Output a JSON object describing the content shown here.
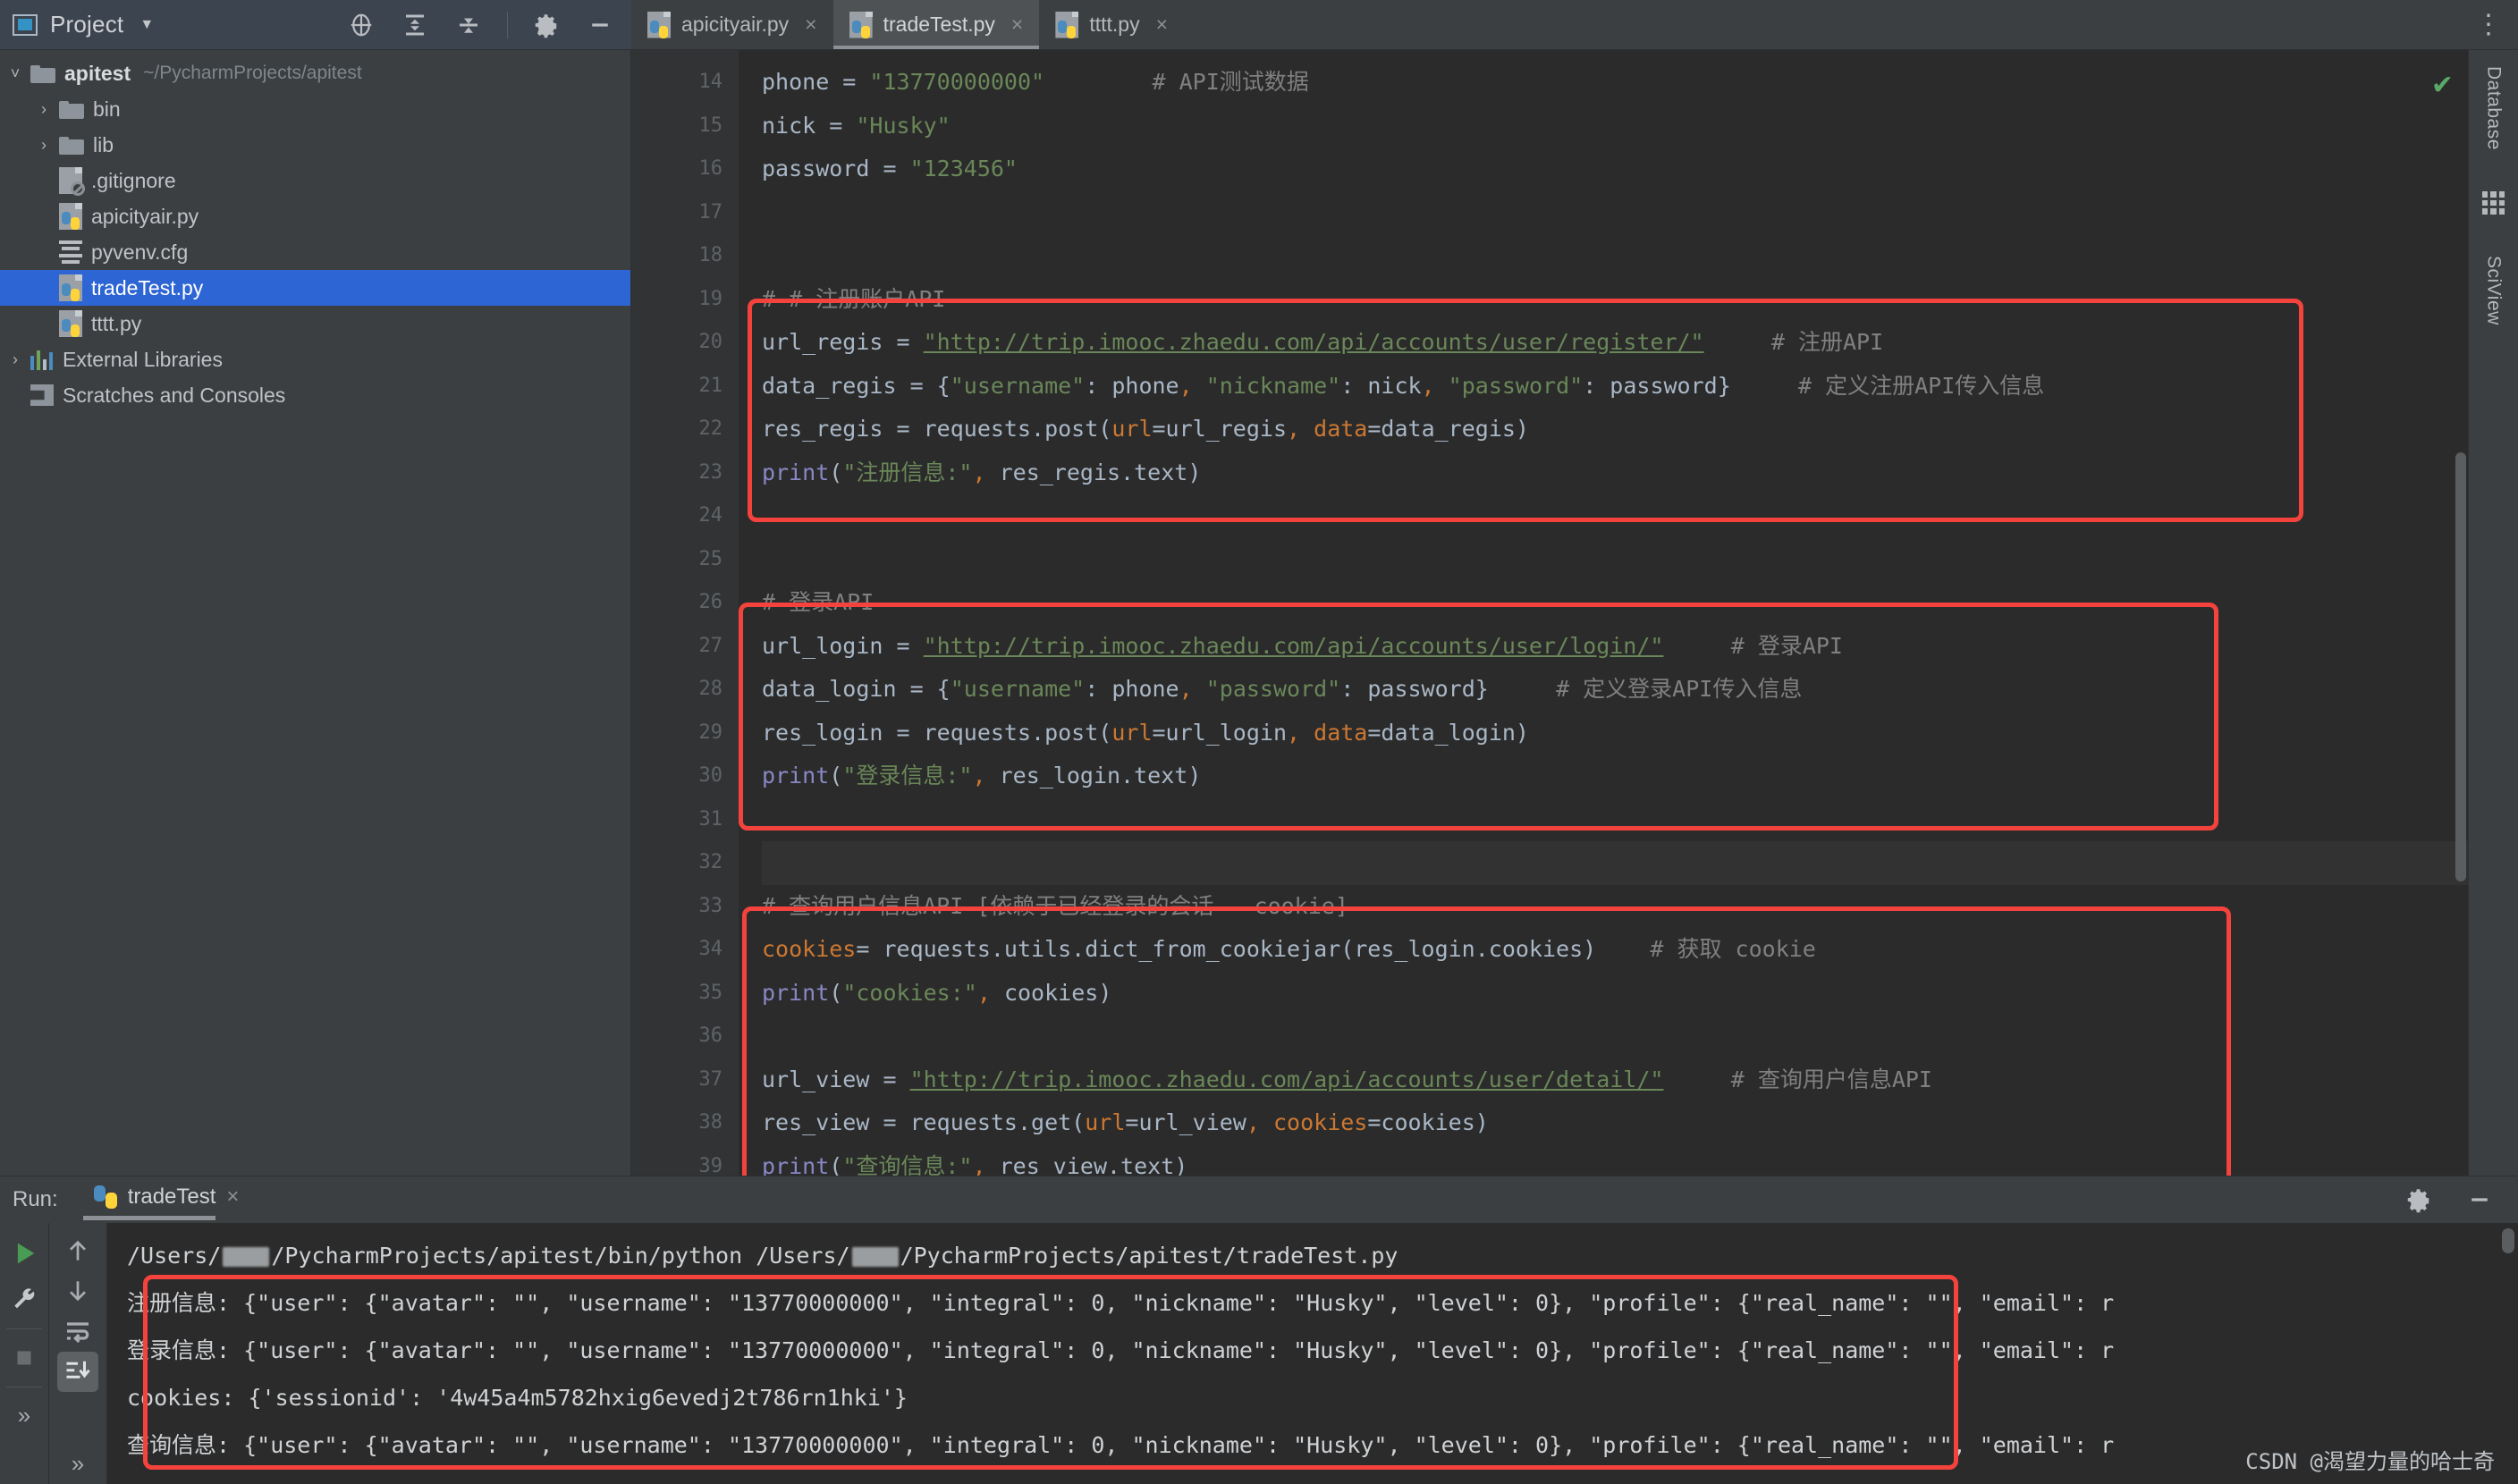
{
  "window": {
    "project_panel_title": "Project",
    "toolbar_icons": [
      "locate-icon",
      "expand-all-icon",
      "collapse-all-icon",
      "gear-icon",
      "minimize-icon"
    ]
  },
  "tabs": [
    {
      "label": "apicityair.py",
      "icon": "python-file-icon",
      "active": false,
      "close": "×"
    },
    {
      "label": "tradeTest.py",
      "icon": "python-file-icon",
      "active": true,
      "close": "×"
    },
    {
      "label": "tttt.py",
      "icon": "python-file-icon",
      "active": false,
      "close": "×"
    }
  ],
  "tabbar_overflow": "⋮",
  "tree": [
    {
      "label": "apitest",
      "sub": "~/PycharmProjects/apitest",
      "icon": "folder-icon",
      "arrow": "˅",
      "indent": 0,
      "bold": true,
      "selected": false
    },
    {
      "label": "bin",
      "sub": "",
      "icon": "folder-icon",
      "arrow": "›",
      "indent": 1,
      "bold": false,
      "selected": false
    },
    {
      "label": "lib",
      "sub": "",
      "icon": "folder-icon",
      "arrow": "›",
      "indent": 1,
      "bold": false,
      "selected": false
    },
    {
      "label": ".gitignore",
      "sub": "",
      "icon": "gitignore-file-icon",
      "arrow": "",
      "indent": 2,
      "bold": false,
      "selected": false
    },
    {
      "label": "apicityair.py",
      "sub": "",
      "icon": "python-file-icon",
      "arrow": "",
      "indent": 2,
      "bold": false,
      "selected": false
    },
    {
      "label": "pyvenv.cfg",
      "sub": "",
      "icon": "config-file-icon",
      "arrow": "",
      "indent": 2,
      "bold": false,
      "selected": false
    },
    {
      "label": "tradeTest.py",
      "sub": "",
      "icon": "python-file-icon",
      "arrow": "",
      "indent": 2,
      "bold": false,
      "selected": true
    },
    {
      "label": "tttt.py",
      "sub": "",
      "icon": "python-file-icon",
      "arrow": "",
      "indent": 2,
      "bold": false,
      "selected": false
    },
    {
      "label": "External Libraries",
      "sub": "",
      "icon": "library-icon",
      "arrow": "›",
      "indent": 0,
      "bold": false,
      "selected": false
    },
    {
      "label": "Scratches and Consoles",
      "sub": "",
      "icon": "scratches-icon",
      "arrow": "",
      "indent": 0,
      "bold": false,
      "selected": false
    }
  ],
  "editor": {
    "first_line_number": 14,
    "line_numbers": [
      14,
      15,
      16,
      17,
      18,
      19,
      20,
      21,
      22,
      23,
      24,
      25,
      26,
      27,
      28,
      29,
      30,
      31,
      32,
      33,
      34,
      35,
      36,
      37,
      38,
      39
    ],
    "current_line": 32,
    "lines": [
      "phone = \"13770000000\"        # API测试数据",
      "nick = \"Husky\"",
      "password = \"123456\"",
      "",
      "",
      "# # 注册账户API",
      "url_regis = \"http://trip.imooc.zhaedu.com/api/accounts/user/register/\"     # 注册API",
      "data_regis = {\"username\": phone, \"nickname\": nick, \"password\": password}     # 定义注册API传入信息",
      "res_regis = requests.post(url=url_regis, data=data_regis)",
      "print(\"注册信息:\", res_regis.text)",
      "",
      "",
      "# 登录API",
      "url_login = \"http://trip.imooc.zhaedu.com/api/accounts/user/login/\"     # 登录API",
      "data_login = {\"username\": phone, \"password\": password}     # 定义登录API传入信息",
      "res_login = requests.post(url=url_login, data=data_login)",
      "print(\"登录信息:\", res_login.text)",
      "",
      "",
      "# 查询用户信息API [依赖于已经登录的会话 - cookie]",
      "cookies = requests.utils.dict_from_cookiejar(res_login.cookies)    # 获取 cookie",
      "print(\"cookies:\", cookies)",
      "",
      "url_view = \"http://trip.imooc.zhaedu.com/api/accounts/user/detail/\"     # 查询用户信息API",
      "res_view = requests.get(url=url_view, cookies=cookies)",
      "print(\"查询信息:\", res_view.text)"
    ],
    "inspection_status": "✔"
  },
  "right_strip": {
    "database_label": "Database",
    "sciview_label": "SciView"
  },
  "run_panel": {
    "label": "Run:",
    "tab_name": "tradeTest",
    "tab_close": "×",
    "gear": "gear-icon",
    "minimize": "minimize-icon",
    "tools_left": [
      "run-icon",
      "wrench-icon",
      "stop-icon",
      "more-icon"
    ],
    "tools_right": [
      "arrow-up-icon",
      "arrow-down-icon",
      "soft-wrap-icon",
      "scroll-to-end-icon",
      "more-icon"
    ],
    "console": {
      "command_prefix": "/Users/",
      "command_mid": "/PycharmProjects/apitest/bin/python /Users/",
      "command_suffix": "/PycharmProjects/apitest/tradeTest.py",
      "lines": [
        "注册信息: {\"user\": {\"avatar\": \"\", \"username\": \"13770000000\", \"integral\": 0, \"nickname\": \"Husky\", \"level\": 0}, \"profile\": {\"real_name\": \"\", \"email\": r",
        "登录信息: {\"user\": {\"avatar\": \"\", \"username\": \"13770000000\", \"integral\": 0, \"nickname\": \"Husky\", \"level\": 0}, \"profile\": {\"real_name\": \"\", \"email\": r",
        "cookies: {'sessionid': '4w45a4m5782hxig6evedj2t786rn1hki'}",
        "查询信息: {\"user\": {\"avatar\": \"\", \"username\": \"13770000000\", \"integral\": 0, \"nickname\": \"Husky\", \"level\": 0}, \"profile\": {\"real_name\": \"\", \"email\": r"
      ]
    }
  },
  "watermark": "CSDN @渴望力量的哈士奇",
  "colors": {
    "accent_selection": "#2d65d4",
    "annotation_red": "#f4433c",
    "editor_bg": "#2b2b2b",
    "panel_bg": "#3c3f41",
    "string_green": "#6a8759",
    "keyword_orange": "#cc7832",
    "comment_gray": "#808080",
    "function_purple": "#8888c6",
    "ok_green": "#59a869"
  }
}
